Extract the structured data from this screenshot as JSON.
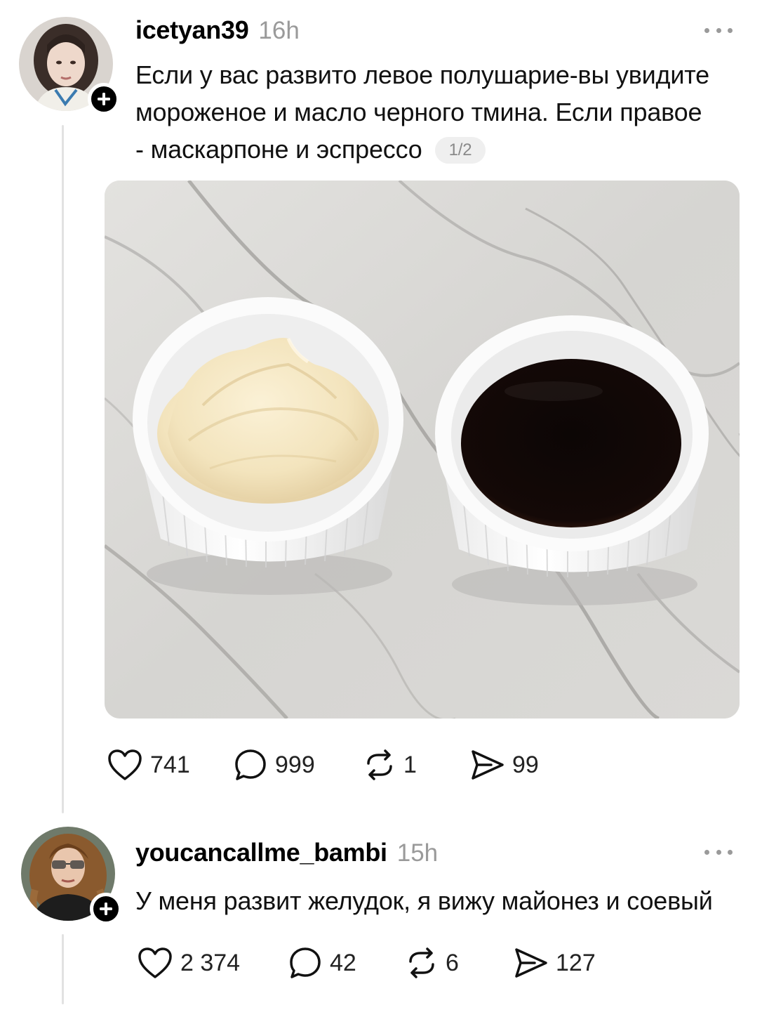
{
  "posts": [
    {
      "username": "icetyan39",
      "time": "16h",
      "text_lines": [
        "Если у вас развито левое полушарие-вы увидите",
        "мороженое и масло черного тмина. Если правое",
        "- маскарпоне и эспрессо"
      ],
      "media_counter": "1/2",
      "icons": [
        "heart-icon",
        "comment-icon",
        "repost-icon",
        "share-icon",
        "more-icon",
        "plus-icon"
      ],
      "likes": "741",
      "comments": "999",
      "reposts": "1",
      "shares": "99"
    },
    {
      "username": "youcancallme_bambi",
      "time": "15h",
      "text": "У меня развит желудок, я вижу майонез и соевый",
      "likes": "2 374",
      "comments": "42",
      "reposts": "6",
      "shares": "127"
    }
  ]
}
